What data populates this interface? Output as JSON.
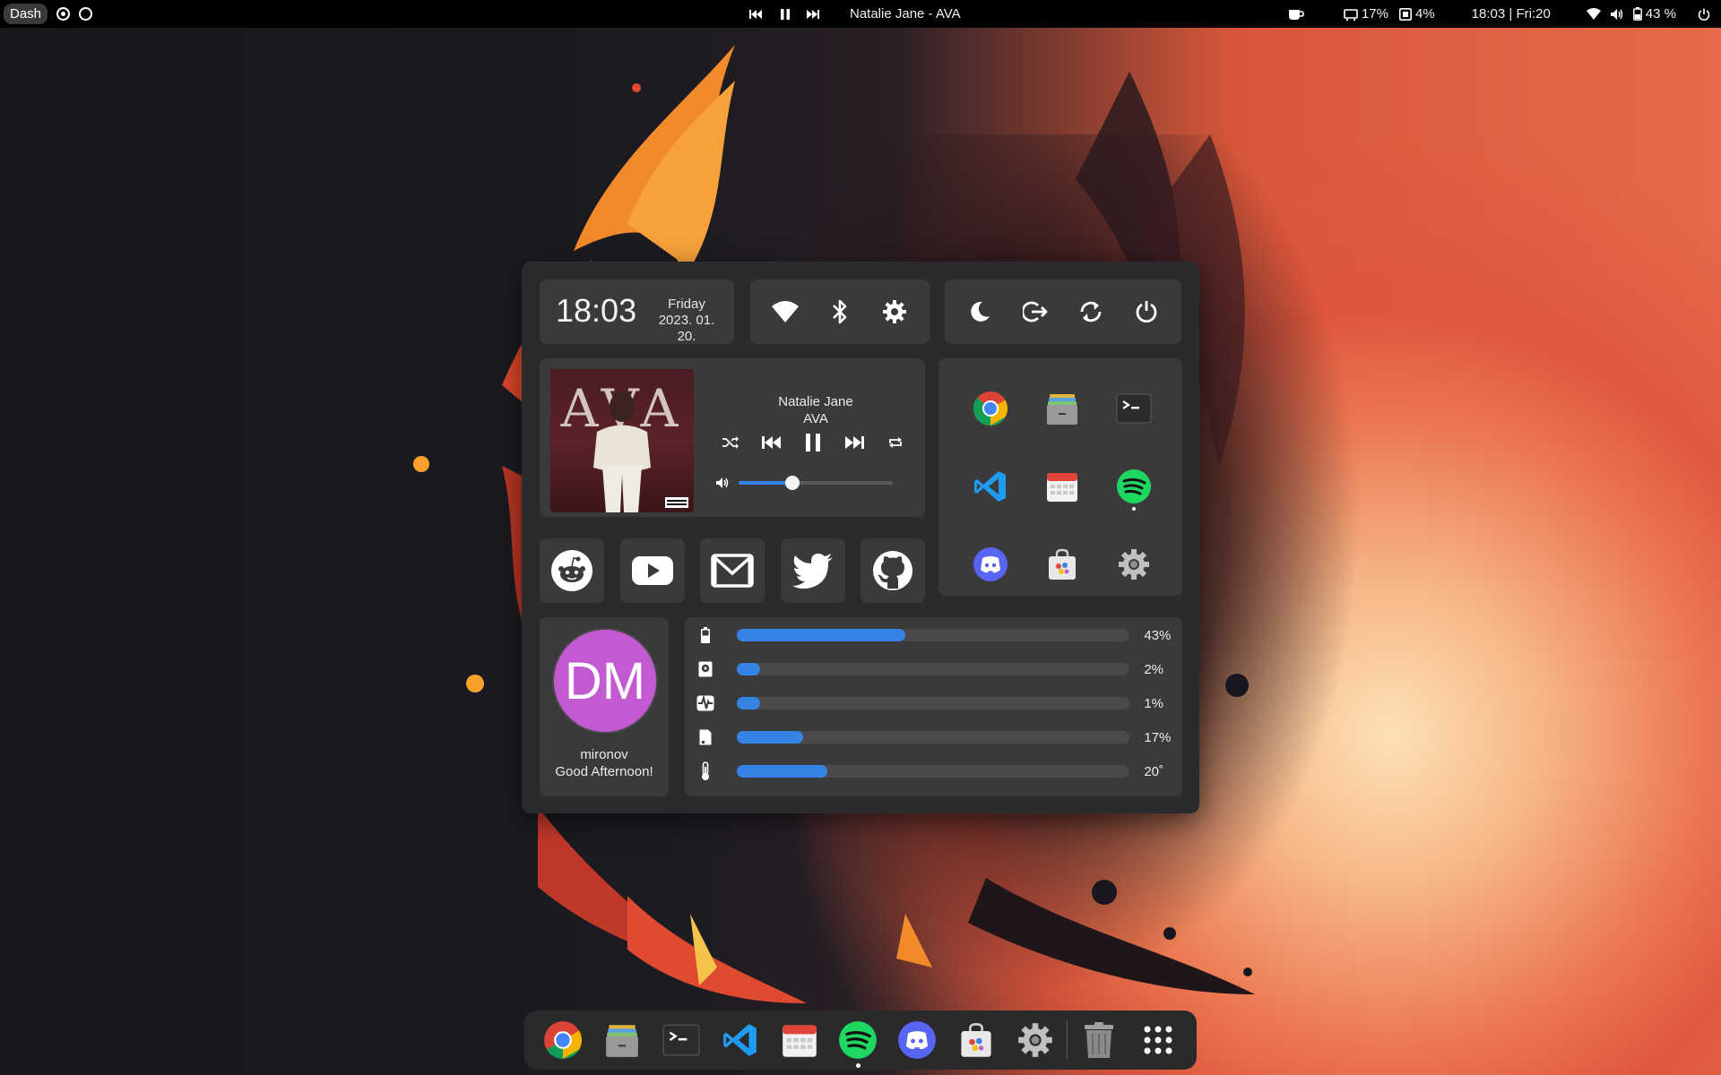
{
  "topbar": {
    "dash_label": "Dash",
    "media_title": "Natalie Jane - AVA",
    "cpu_label": "17%",
    "mem_label": "4%",
    "datetime": "18:03 | Fri:20",
    "battery_label": "43 %"
  },
  "clock": {
    "time": "18:03",
    "day": "Friday",
    "date": "2023. 01. 20."
  },
  "media": {
    "artist": "Natalie Jane",
    "track": "AVA",
    "album_art_text": "AVA",
    "volume_percent": 35
  },
  "quick_settings": {
    "icons": [
      "wifi-icon",
      "bluetooth-icon",
      "settings-icon"
    ]
  },
  "power_menu": {
    "icons": [
      "sleep-icon",
      "logout-icon",
      "restart-icon",
      "power-icon"
    ]
  },
  "apps": [
    "Chrome",
    "Files",
    "Terminal",
    "Visual Studio Code",
    "Calendar",
    "Spotify",
    "Discord",
    "Software",
    "Settings"
  ],
  "web_links": [
    "Reddit",
    "YouTube",
    "Gmail",
    "Twitter",
    "GitHub"
  ],
  "user": {
    "initials": "DM",
    "name": "mironov",
    "greeting": "Good Afternoon!",
    "avatar_color": "#c35ad1"
  },
  "stats": [
    {
      "icon": "battery-icon",
      "value": 43,
      "label": "43%"
    },
    {
      "icon": "storage-icon",
      "value": 2,
      "label": "2%"
    },
    {
      "icon": "cpu-icon",
      "value": 1,
      "label": "1%"
    },
    {
      "icon": "memory-icon",
      "value": 17,
      "label": "17%"
    },
    {
      "icon": "temperature-icon",
      "value": 23,
      "label": "20˚"
    }
  ],
  "dock": [
    "Chrome",
    "Files",
    "Terminal",
    "Visual Studio Code",
    "Calendar",
    "Spotify",
    "Discord",
    "Software",
    "Settings",
    "Trash",
    "Show Applications"
  ],
  "colors": {
    "accent": "#3584e4",
    "panel": "#2b2b2d",
    "card": "#3a3a3c"
  }
}
